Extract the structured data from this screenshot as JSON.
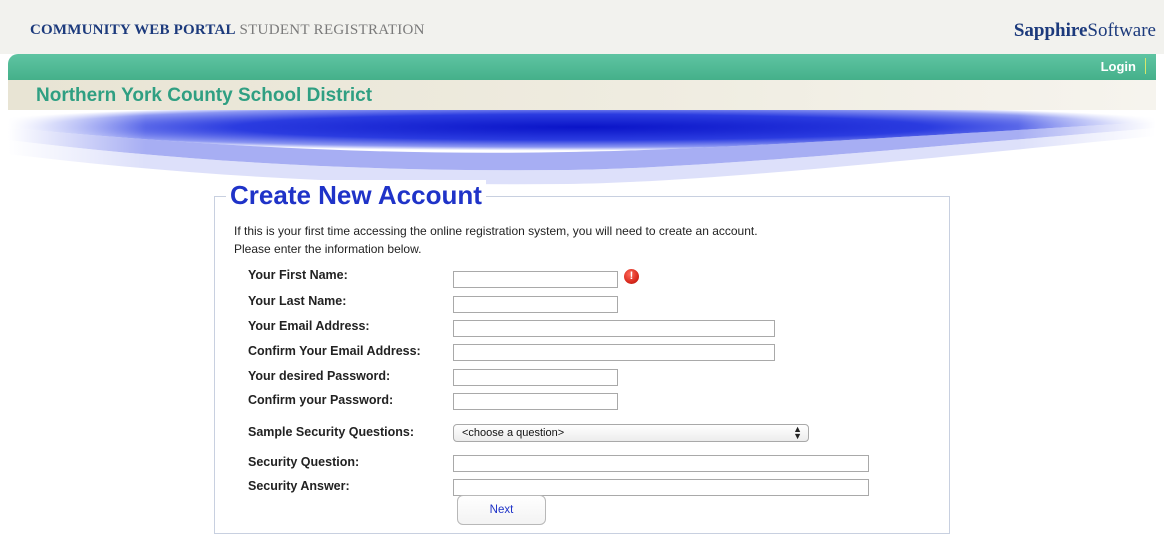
{
  "header": {
    "portal_title_bold": "COMMUNITY WEB PORTAL",
    "portal_title_sub": "STUDENT REGISTRATION",
    "brand_bold": "Sapphire",
    "brand_light": "Software"
  },
  "nav": {
    "login_label": "Login"
  },
  "district": {
    "name": "Northern York County School District"
  },
  "form": {
    "legend": "Create New Account",
    "intro_line1": "If this is your first time accessing the online registration system, you will need to create an account.",
    "intro_line2": "Please enter the information below.",
    "fields": [
      {
        "label": "Your First Name:",
        "value": ""
      },
      {
        "label": "Your Last Name:",
        "value": ""
      },
      {
        "label": "Your Email Address:",
        "value": ""
      },
      {
        "label": "Confirm Your Email Address:",
        "value": ""
      },
      {
        "label": "Your desired Password:",
        "value": ""
      },
      {
        "label": "Confirm your Password:",
        "value": ""
      },
      {
        "label": "Sample Security Questions:",
        "selected": "<choose a question>"
      },
      {
        "label": "Security Question:",
        "value": ""
      },
      {
        "label": "Security Answer:",
        "value": ""
      }
    ],
    "error_icon_glyph": "!",
    "next_label": "Next"
  },
  "colors": {
    "brand_navy": "#1c3a7c",
    "green_band": "#45b08a",
    "district_text": "#2f9f82",
    "legend_blue": "#1f33c8",
    "error_red": "#d92a1e"
  },
  "icons": {
    "error": "exclamation-circle-icon",
    "select_arrows": "updown-arrows-icon"
  }
}
